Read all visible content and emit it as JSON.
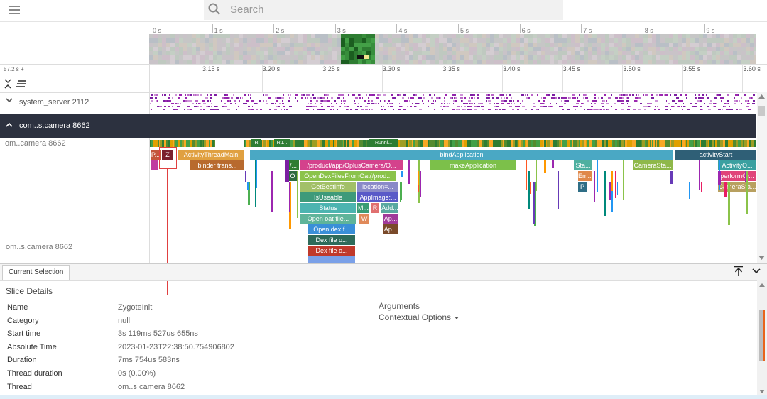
{
  "search": {
    "placeholder": "Search"
  },
  "overview": {
    "ticks": [
      "0 s",
      "1 s",
      "2 s",
      "3 s",
      "4 s",
      "5 s",
      "6 s",
      "7 s",
      "8 s",
      "9 s"
    ]
  },
  "timeline": {
    "offset_label": "57.2 s +",
    "ticks": [
      "3.15 s",
      "3.20 s",
      "3.25 s",
      "3.30 s",
      "3.35 s",
      "3.40 s",
      "3.45 s",
      "3.50 s",
      "3.55 s",
      "3.60 s"
    ]
  },
  "tracks": {
    "system_server": "system_server 2112",
    "process": "com.​​.s.camera 8662",
    "thread_main": "om.​​.camera 8662",
    "thread_second": "om.​​.s.camera 8662"
  },
  "state_slices": {
    "r1": "R",
    "r2": "Ru...",
    "r3": "Runni..."
  },
  "slices": {
    "p": "P...",
    "z": "Z",
    "activity_thread_main": "ActivityThreadMain",
    "binder_trans": "binder trans...",
    "bind_application": "bindApplication",
    "activity_start": "activityStart",
    "slash": "/...",
    "product_app": "/product/app/OplusCamera/O...",
    "make_application": "makeApplication",
    "sta": "Sta...",
    "camera_sta": "CameraSta...",
    "activity_o": "ActivityO...",
    "o": "O",
    "open_dex_files": "OpenDexFilesFromOat(/prod...",
    "em": "Em...",
    "perform_cr": "performCr...",
    "get_best_info": "GetBestInfo",
    "location": "location=...",
    "p2": "P",
    "camera_sta2": "CameraSta...",
    "is_useable": "IsUseable",
    "app_image": "AppImage:...",
    "status": "Status",
    "m": "M...",
    "r": "R",
    "add": "Add...",
    "open_oat": "Open oat file...",
    "w": "W",
    "ap1": "Ap...",
    "open_dex_f": "Open dex f...",
    "ap2": "Ap...",
    "dex_file_o1": "Dex file o...",
    "dex_file_o2": "Dex file o..."
  },
  "bottom": {
    "tab": "Current Selection",
    "title": "Slice Details",
    "details": [
      {
        "key": "Name",
        "value": "ZygoteInit"
      },
      {
        "key": "Category",
        "value": "null"
      },
      {
        "key": "Start time",
        "value": "3s 119ms 527us 655ns"
      },
      {
        "key": "Absolute Time",
        "value": "2023-01-23T22:38:50.754906802"
      },
      {
        "key": "Duration",
        "value": "7ms 754us 583ns"
      },
      {
        "key": "Thread duration",
        "value": "0s (0.00%)"
      },
      {
        "key": "Thread",
        "value": "om.​​.s camera 8662"
      }
    ],
    "arguments": "Arguments",
    "contextual": "Contextual Options"
  },
  "colors": {
    "header_bg": "#2c313f",
    "accent_orange": "#e8631a",
    "annotation": "#e04040"
  }
}
